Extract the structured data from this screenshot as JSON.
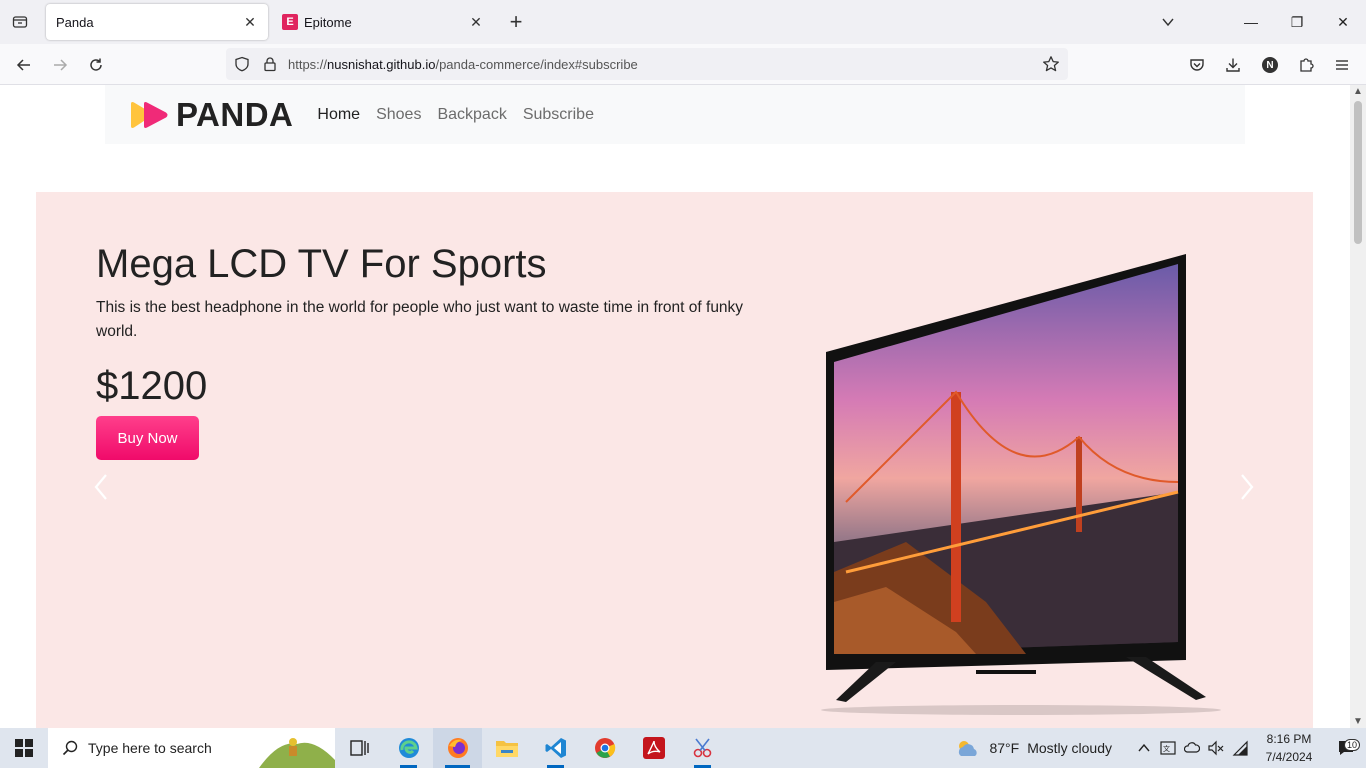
{
  "browser": {
    "tabs": [
      {
        "title": "Panda",
        "active": true
      },
      {
        "title": "Epitome",
        "active": false,
        "favicon_letter": "E"
      }
    ],
    "url": {
      "prefix": "https://",
      "host": "nusnishat.github.io",
      "path": "/panda-commerce/index#subscribe"
    },
    "profile_initial": "N"
  },
  "site": {
    "logo_text": "PANDA",
    "nav": [
      "Home",
      "Shoes",
      "Backpack",
      "Subscribe"
    ]
  },
  "hero": {
    "title": "Mega LCD TV For Sports",
    "description": "This is the best headphone in the world for people who just want to waste time in front of funky world.",
    "price": "$1200",
    "button": "Buy Now"
  },
  "taskbar": {
    "search_placeholder": "Type here to search",
    "weather_temp": "87°F",
    "weather_desc": "Mostly cloudy",
    "time": "8:16 PM",
    "date": "7/4/2024",
    "notification_count": "10"
  },
  "colors": {
    "hero_bg": "#fbe7e6",
    "button_pink": "#f81a78",
    "logo_yellow": "#ffc43d",
    "logo_pink": "#f02a78"
  }
}
